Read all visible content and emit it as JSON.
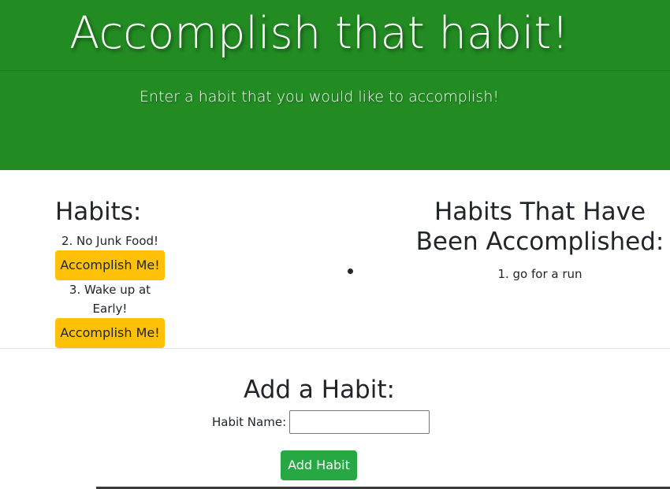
{
  "header": {
    "title": "Accomplish that habit!",
    "subtitle": "Enter a habit that you would like to accomplish!",
    "background": "#228b22"
  },
  "habits": {
    "title": "Habits:",
    "items": [
      {
        "label": "2. No Junk Food!",
        "button": "Accomplish Me!"
      },
      {
        "label": "3. Wake up at Early!",
        "button": "Accomplish Me!"
      }
    ],
    "button_color": "#ffc107"
  },
  "accomplished": {
    "title": "Habits That Have Been Accomplished:",
    "items": [
      "1. go for a run"
    ]
  },
  "add_form": {
    "title": "Add a Habit:",
    "label": "Habit Name:",
    "input_value": "",
    "submit_label": "Add Habit",
    "submit_color": "#28a745"
  }
}
